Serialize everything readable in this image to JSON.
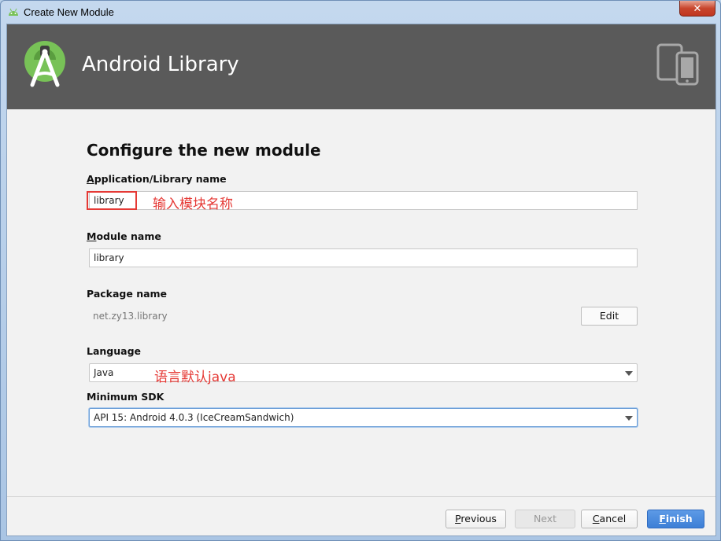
{
  "window": {
    "title": "Create New Module",
    "close_label": "✕"
  },
  "header": {
    "title": "Android Library"
  },
  "form": {
    "heading": "Configure the new module",
    "app_name": {
      "label_first": "A",
      "label_rest": "pplication/Library name",
      "value": "library",
      "annotation": "输入模块名称"
    },
    "module_name": {
      "label_first": "M",
      "label_rest": "odule name",
      "value": "library"
    },
    "package_name": {
      "label": "Package name",
      "value": "net.zy13.library",
      "edit_label": "Edit"
    },
    "language": {
      "label": "Language",
      "value": "Java",
      "annotation": "语言默认java"
    },
    "min_sdk": {
      "label": "Minimum SDK",
      "value": "API 15: Android 4.0.3 (IceCreamSandwich)"
    }
  },
  "footer": {
    "previous_first": "P",
    "previous_rest": "revious",
    "next_label": "Next",
    "cancel_first": "C",
    "cancel_rest": "ancel",
    "finish_first": "F",
    "finish_rest": "inish"
  },
  "colors": {
    "header_bg": "#5a5a5a",
    "android_green": "#78c257",
    "annotation_red": "#e53935",
    "primary_button": "#3d7fd6"
  }
}
